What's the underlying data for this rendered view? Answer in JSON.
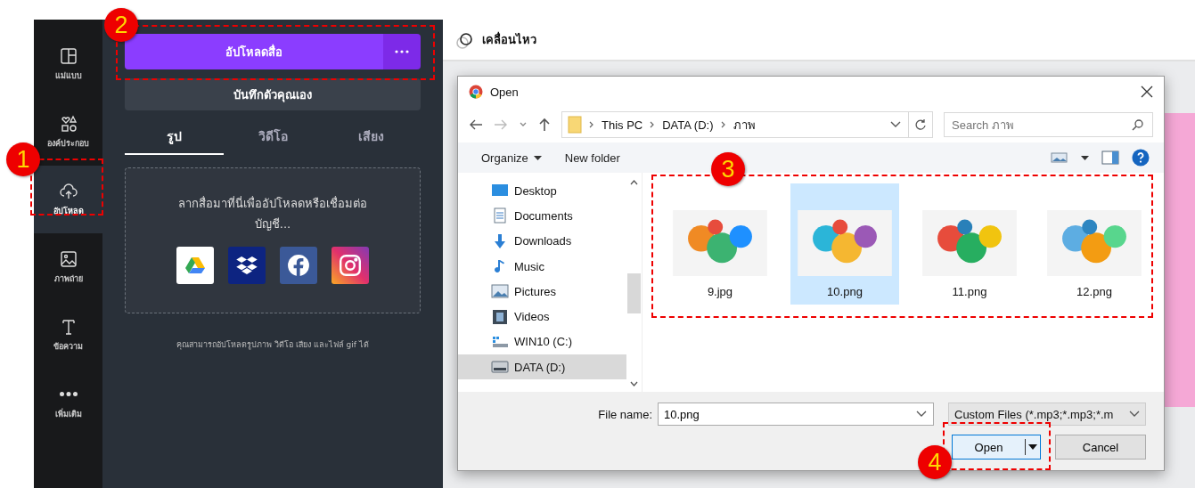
{
  "rail": [
    {
      "label": "แม่แบบ",
      "kind": "layout",
      "selected": false
    },
    {
      "label": "องค์ประกอบ",
      "kind": "shapes",
      "selected": false
    },
    {
      "label": "อัปโหลด",
      "kind": "upload",
      "selected": true
    },
    {
      "label": "ภาพถ่าย",
      "kind": "photo",
      "selected": false
    },
    {
      "label": "ข้อความ",
      "kind": "text",
      "selected": false
    },
    {
      "label": "เพิ่มเติม",
      "kind": "more",
      "selected": false
    }
  ],
  "panel": {
    "upload_button": "อัปโหลดสื่อ",
    "record_button": "บันทึกตัวคุณเอง",
    "tabs": [
      {
        "label": "รูป",
        "selected": true
      },
      {
        "label": "วิดีโอ",
        "selected": false
      },
      {
        "label": "เสียง",
        "selected": false
      }
    ],
    "dropzone_text": "ลากสื่อมาที่นี่เพื่ออัปโหลดหรือเชื่อมต่อบัญชี...",
    "services": [
      {
        "kind": "drive"
      },
      {
        "kind": "dropbox"
      },
      {
        "kind": "facebook"
      },
      {
        "kind": "instagram"
      }
    ],
    "note": "คุณสามารถอัปโหลดรูปภาพ วิดีโอ เสียง และไฟล์ gif ได้"
  },
  "topbar": {
    "label": "เคลื่อนไหว"
  },
  "dialog": {
    "title": "Open",
    "breadcrumb": [
      "This PC",
      "DATA (D:)",
      "ภาพ"
    ],
    "search": {
      "placeholder": "Search ภาพ"
    },
    "toolbar": [
      "Organize",
      "New folder"
    ],
    "nav": [
      {
        "label": "Desktop",
        "kind": "desktop",
        "selected": false
      },
      {
        "label": "Documents",
        "kind": "documents",
        "selected": false
      },
      {
        "label": "Downloads",
        "kind": "downloads",
        "selected": false
      },
      {
        "label": "Music",
        "kind": "music",
        "selected": false
      },
      {
        "label": "Pictures",
        "kind": "pictures",
        "selected": false
      },
      {
        "label": "Videos",
        "kind": "videos",
        "selected": false
      },
      {
        "label": "WIN10 (C:)",
        "kind": "system_drive",
        "selected": false
      },
      {
        "label": "DATA (D:)",
        "kind": "drive",
        "selected": true
      }
    ],
    "files": [
      {
        "name": "9.jpg",
        "selected": false
      },
      {
        "name": "10.png",
        "selected": true
      },
      {
        "name": "11.png",
        "selected": false
      },
      {
        "name": "12.png",
        "selected": false
      }
    ],
    "file_name_label": "File name:",
    "file_name": {
      "value": "10.png"
    },
    "file_type": "Custom Files (*.mp3;*.mp3;*.m",
    "buttons": {
      "open": "Open",
      "cancel": "Cancel"
    }
  },
  "annotations": [
    "1",
    "2",
    "3",
    "4"
  ]
}
